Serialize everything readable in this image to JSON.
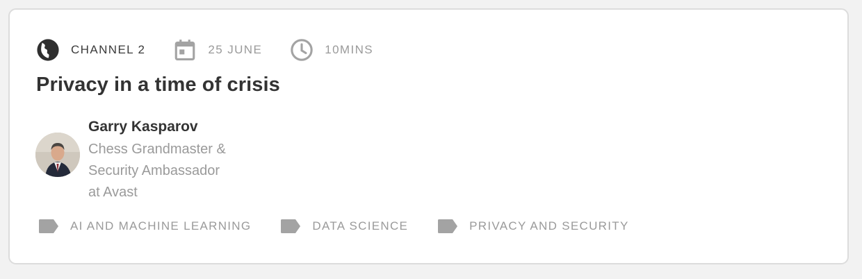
{
  "session": {
    "channel": "CHANNEL 2",
    "date": "25 JUNE",
    "duration": "10MINS",
    "title": "Privacy in a time of crisis"
  },
  "speaker": {
    "name": "Garry Kasparov",
    "role_line1": "Chess Grandmaster &",
    "role_line2": "Security Ambassador",
    "role_line3": "at Avast"
  },
  "tags": [
    {
      "label": "AI AND MACHINE LEARNING",
      "icon": "tag-icon"
    },
    {
      "label": "DATA SCIENCE",
      "icon": "tag-icon"
    },
    {
      "label": "PRIVACY AND SECURITY",
      "icon": "tag-icon"
    }
  ],
  "icons": {
    "channel": "globe-icon",
    "date": "calendar-icon",
    "duration": "clock-icon"
  },
  "colors": {
    "primary_text": "#333333",
    "muted_text": "#9a9a9a",
    "icon_dark": "#2f2f2f",
    "icon_muted": "#a3a3a3",
    "card_border": "#dcdcdc",
    "background": "#f2f2f2"
  }
}
